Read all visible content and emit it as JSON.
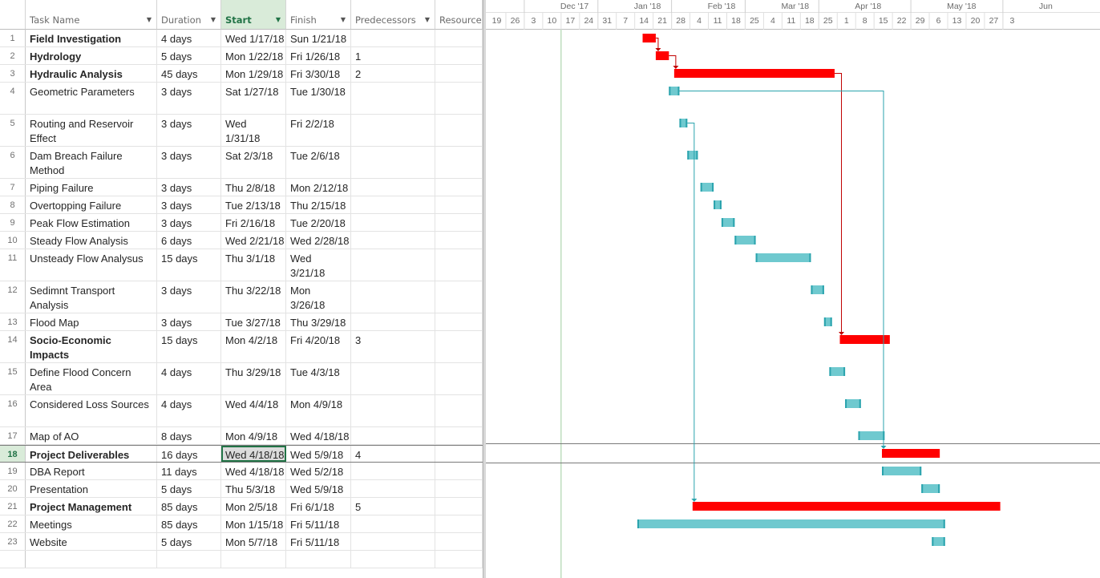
{
  "columns": [
    {
      "key": "id",
      "label": ""
    },
    {
      "key": "task_name",
      "label": "Task Name"
    },
    {
      "key": "duration",
      "label": "Duration"
    },
    {
      "key": "start",
      "label": "Start"
    },
    {
      "key": "finish",
      "label": "Finish"
    },
    {
      "key": "predecessors",
      "label": "Predecessors"
    },
    {
      "key": "resources",
      "label": "Resource Names"
    }
  ],
  "tasks": [
    {
      "id": "1",
      "name": "Field Investigation",
      "duration": "4 days",
      "start": "Wed 1/17/18",
      "finish": "Sun 1/21/18",
      "pred": "",
      "bold": true
    },
    {
      "id": "2",
      "name": "Hydrology",
      "duration": "5 days",
      "start": "Mon 1/22/18",
      "finish": "Fri 1/26/18",
      "pred": "1",
      "bold": true
    },
    {
      "id": "3",
      "name": "Hydraulic Analysis",
      "duration": "45 days",
      "start": "Mon 1/29/18",
      "finish": "Fri 3/30/18",
      "pred": "2",
      "bold": true
    },
    {
      "id": "4",
      "name": "Geometric Parameters",
      "duration": "3 days",
      "start": "Sat 1/27/18",
      "finish": "Tue 1/30/18",
      "pred": "",
      "bold": false
    },
    {
      "id": "5",
      "name": "Routing and Reservoir Effect",
      "duration": "3 days",
      "start": "Wed 1/31/18",
      "finish": "Fri 2/2/18",
      "pred": "",
      "bold": false
    },
    {
      "id": "6",
      "name": "Dam Breach Failure Method",
      "duration": "3 days",
      "start": "Sat 2/3/18",
      "finish": "Tue 2/6/18",
      "pred": "",
      "bold": false
    },
    {
      "id": "7",
      "name": "Piping Failure",
      "duration": "3 days",
      "start": "Thu 2/8/18",
      "finish": "Mon 2/12/18",
      "pred": "",
      "bold": false
    },
    {
      "id": "8",
      "name": "Overtopping Failure",
      "duration": "3 days",
      "start": "Tue 2/13/18",
      "finish": "Thu 2/15/18",
      "pred": "",
      "bold": false
    },
    {
      "id": "9",
      "name": "Peak Flow Estimation",
      "duration": "3 days",
      "start": "Fri 2/16/18",
      "finish": "Tue 2/20/18",
      "pred": "",
      "bold": false
    },
    {
      "id": "10",
      "name": "Steady Flow Analysis",
      "duration": "6 days",
      "start": "Wed 2/21/18",
      "finish": "Wed 2/28/18",
      "pred": "",
      "bold": false
    },
    {
      "id": "11",
      "name": "Unsteady Flow Analysus",
      "duration": "15 days",
      "start": "Thu 3/1/18",
      "finish": "Wed 3/21/18",
      "pred": "",
      "bold": false
    },
    {
      "id": "12",
      "name": "Sedimnt Transport Analysis",
      "duration": "3 days",
      "start": "Thu 3/22/18",
      "finish": "Mon 3/26/18",
      "pred": "",
      "bold": false
    },
    {
      "id": "13",
      "name": "Flood Map",
      "duration": "3 days",
      "start": "Tue 3/27/18",
      "finish": "Thu 3/29/18",
      "pred": "",
      "bold": false
    },
    {
      "id": "14",
      "name": "Socio-Economic Impacts",
      "duration": "15 days",
      "start": "Mon 4/2/18",
      "finish": "Fri 4/20/18",
      "pred": "3",
      "bold": true
    },
    {
      "id": "15",
      "name": "Define Flood Concern Area",
      "duration": "4 days",
      "start": "Thu 3/29/18",
      "finish": "Tue 4/3/18",
      "pred": "",
      "bold": false
    },
    {
      "id": "16",
      "name": "Considered Loss Sources",
      "duration": "4 days",
      "start": "Wed 4/4/18",
      "finish": "Mon 4/9/18",
      "pred": "",
      "bold": false
    },
    {
      "id": "17",
      "name": "Map of AO",
      "duration": "8 days",
      "start": "Mon 4/9/18",
      "finish": "Wed 4/18/18",
      "pred": "",
      "bold": false
    },
    {
      "id": "18",
      "name": "Project Deliverables",
      "duration": "16 days",
      "start": "Wed 4/18/18",
      "finish": "Wed 5/9/18",
      "pred": "4",
      "bold": true
    },
    {
      "id": "19",
      "name": "DBA Report",
      "duration": "11 days",
      "start": "Wed 4/18/18",
      "finish": "Wed 5/2/18",
      "pred": "",
      "bold": false
    },
    {
      "id": "20",
      "name": "Presentation",
      "duration": "5 days",
      "start": "Thu 5/3/18",
      "finish": "Wed 5/9/18",
      "pred": "",
      "bold": false
    },
    {
      "id": "21",
      "name": "Project Management",
      "duration": "85 days",
      "start": "Mon 2/5/18",
      "finish": "Fri 6/1/18",
      "pred": "5",
      "bold": true
    },
    {
      "id": "22",
      "name": "Meetings",
      "duration": "85 days",
      "start": "Mon 1/15/18",
      "finish": "Fri 5/11/18",
      "pred": "",
      "bold": false
    },
    {
      "id": "23",
      "name": "Website",
      "duration": "5 days",
      "start": "Mon 5/7/18",
      "finish": "Fri 5/11/18",
      "pred": "",
      "bold": false
    }
  ],
  "selected_row": "18",
  "timescale": {
    "months": [
      {
        "label": "Dec '17",
        "start": "2017-12-03"
      },
      {
        "label": "Jan '18",
        "start": "2017-12-31"
      },
      {
        "label": "Feb '18",
        "start": "2018-01-28"
      },
      {
        "label": "Mar '18",
        "start": "2018-02-25"
      },
      {
        "label": "Apr '18",
        "start": "2018-03-25"
      },
      {
        "label": "May '18",
        "start": "2018-04-29"
      },
      {
        "label": "Jun",
        "start": "2018-06-03"
      }
    ],
    "weeks": [
      "19",
      "26",
      "3",
      "10",
      "17",
      "24",
      "31",
      "7",
      "14",
      "21",
      "28",
      "4",
      "11",
      "18",
      "25",
      "4",
      "11",
      "18",
      "25",
      "1",
      "8",
      "15",
      "22",
      "29",
      "6",
      "13",
      "20",
      "27",
      "3"
    ],
    "first_week": "2017-11-19",
    "current_date": "2017-12-17"
  },
  "bars": [
    {
      "row": 1,
      "start": "2018-01-17",
      "finish": "2018-01-21",
      "kind": "critical"
    },
    {
      "row": 2,
      "start": "2018-01-22",
      "finish": "2018-01-26",
      "kind": "critical"
    },
    {
      "row": 3,
      "start": "2018-01-29",
      "finish": "2018-03-30",
      "kind": "critical"
    },
    {
      "row": 4,
      "start": "2018-01-27",
      "finish": "2018-01-30",
      "kind": "task"
    },
    {
      "row": 5,
      "start": "2018-01-31",
      "finish": "2018-02-02",
      "kind": "task"
    },
    {
      "row": 6,
      "start": "2018-02-03",
      "finish": "2018-02-06",
      "kind": "task"
    },
    {
      "row": 7,
      "start": "2018-02-08",
      "finish": "2018-02-12",
      "kind": "task"
    },
    {
      "row": 8,
      "start": "2018-02-13",
      "finish": "2018-02-15",
      "kind": "task"
    },
    {
      "row": 9,
      "start": "2018-02-16",
      "finish": "2018-02-20",
      "kind": "task"
    },
    {
      "row": 10,
      "start": "2018-02-21",
      "finish": "2018-02-28",
      "kind": "task"
    },
    {
      "row": 11,
      "start": "2018-03-01",
      "finish": "2018-03-21",
      "kind": "task"
    },
    {
      "row": 12,
      "start": "2018-03-22",
      "finish": "2018-03-26",
      "kind": "task"
    },
    {
      "row": 13,
      "start": "2018-03-27",
      "finish": "2018-03-29",
      "kind": "task"
    },
    {
      "row": 14,
      "start": "2018-04-02",
      "finish": "2018-04-20",
      "kind": "critical"
    },
    {
      "row": 15,
      "start": "2018-03-29",
      "finish": "2018-04-03",
      "kind": "task"
    },
    {
      "row": 16,
      "start": "2018-04-04",
      "finish": "2018-04-09",
      "kind": "task"
    },
    {
      "row": 17,
      "start": "2018-04-09",
      "finish": "2018-04-18",
      "kind": "task"
    },
    {
      "row": 18,
      "start": "2018-04-18",
      "finish": "2018-05-09",
      "kind": "critical"
    },
    {
      "row": 19,
      "start": "2018-04-18",
      "finish": "2018-05-02",
      "kind": "task"
    },
    {
      "row": 20,
      "start": "2018-05-03",
      "finish": "2018-05-09",
      "kind": "task"
    },
    {
      "row": 21,
      "start": "2018-02-05",
      "finish": "2018-06-01",
      "kind": "critical"
    },
    {
      "row": 22,
      "start": "2018-01-15",
      "finish": "2018-05-11",
      "kind": "task"
    },
    {
      "row": 23,
      "start": "2018-05-07",
      "finish": "2018-05-11",
      "kind": "task"
    }
  ],
  "links": [
    {
      "from": 1,
      "to": 2,
      "kind": "critical"
    },
    {
      "from": 2,
      "to": 3,
      "kind": "critical"
    },
    {
      "from": 3,
      "to": 14,
      "kind": "critical"
    },
    {
      "from": 4,
      "to": 18,
      "kind": "task"
    },
    {
      "from": 5,
      "to": 21,
      "kind": "task"
    }
  ],
  "colors": {
    "critical": "#ff0000",
    "task": "#6fc9cf",
    "task_edge": "#2aa3ad",
    "link_task": "#2aa3ad",
    "link_critical": "#c00000",
    "selection": "#217346"
  }
}
